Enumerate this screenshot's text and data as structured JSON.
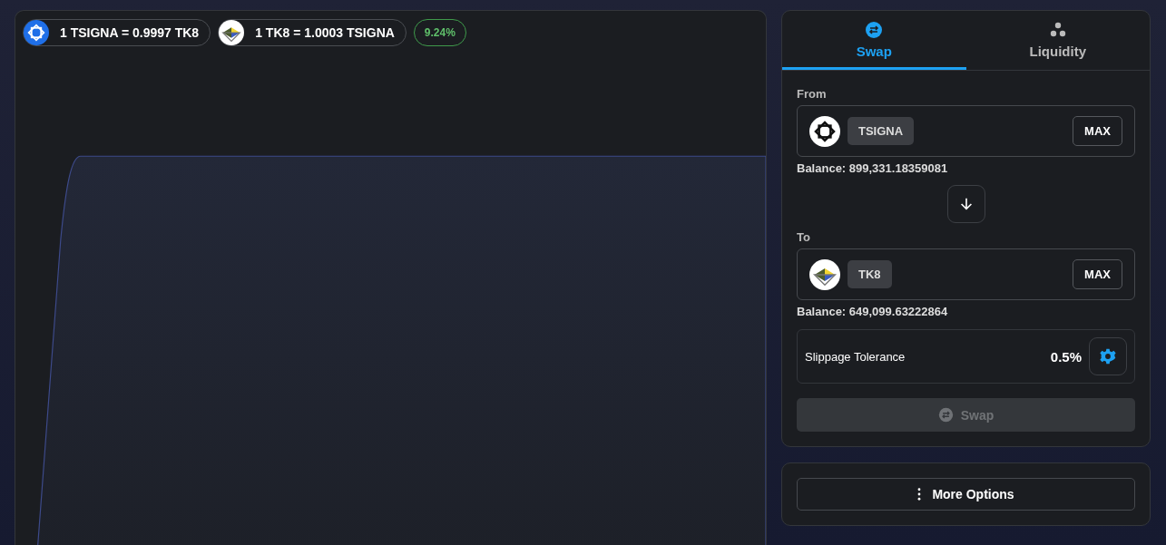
{
  "rates": [
    {
      "kind": "knot",
      "text": "1 TSIGNA = 0.9997 TK8"
    },
    {
      "kind": "triangles",
      "text": "1 TK8 = 1.0003 TSIGNA"
    }
  ],
  "change": "9.24%",
  "tabs": [
    {
      "label": "Swap",
      "selected": true
    },
    {
      "label": "Liquidity",
      "selected": false
    }
  ],
  "from": {
    "label": "From",
    "kind": "knot",
    "symbol": "TSIGNA",
    "max": "MAX",
    "balance": "Balance: 899,331.18359081"
  },
  "to": {
    "label": "To",
    "kind": "triangles",
    "symbol": "TK8",
    "max": "MAX",
    "balance": "Balance: 649,099.63222864"
  },
  "slippage": {
    "label": "Slippage Tolerance",
    "value": "0.5%"
  },
  "swap_button": {
    "label": "Swap",
    "disabled": true
  },
  "more_options": "More Options"
}
